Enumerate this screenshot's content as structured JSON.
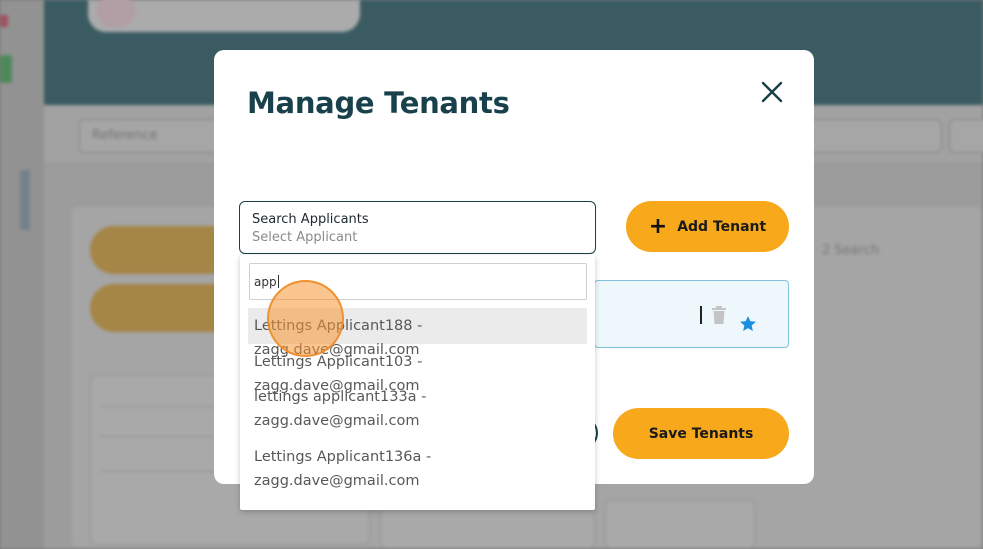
{
  "background": {
    "filter_reference_label": "Reference",
    "date_range_label": "2 Search"
  },
  "modal": {
    "title": "Manage Tenants",
    "search": {
      "label": "Search Applicants",
      "placeholder": "Select Applicant"
    },
    "add_tenant_label": "Add Tenant",
    "save_tenants_label": "Save Tenants"
  },
  "dropdown": {
    "query": "app",
    "options": [
      {
        "line1": "Lettings Applicant188 - zagg.dave@gmail.com",
        "line2": ""
      },
      {
        "line1": "Lettings Applicant103 - zagg.dave@gmail.com",
        "line2": ""
      },
      {
        "line1": "lettings applicant133a -",
        "line2": "zagg.dave@gmail.com"
      },
      {
        "line1": "Lettings Applicant136a -",
        "line2": "zagg.dave@gmail.com"
      }
    ]
  },
  "colors": {
    "accent": "#f7a81b",
    "title": "#18414b",
    "star": "#1a8fe0"
  },
  "icons": {
    "close": "close-icon",
    "add": "plus-icon",
    "delete": "trash-icon",
    "primary": "star-icon"
  }
}
